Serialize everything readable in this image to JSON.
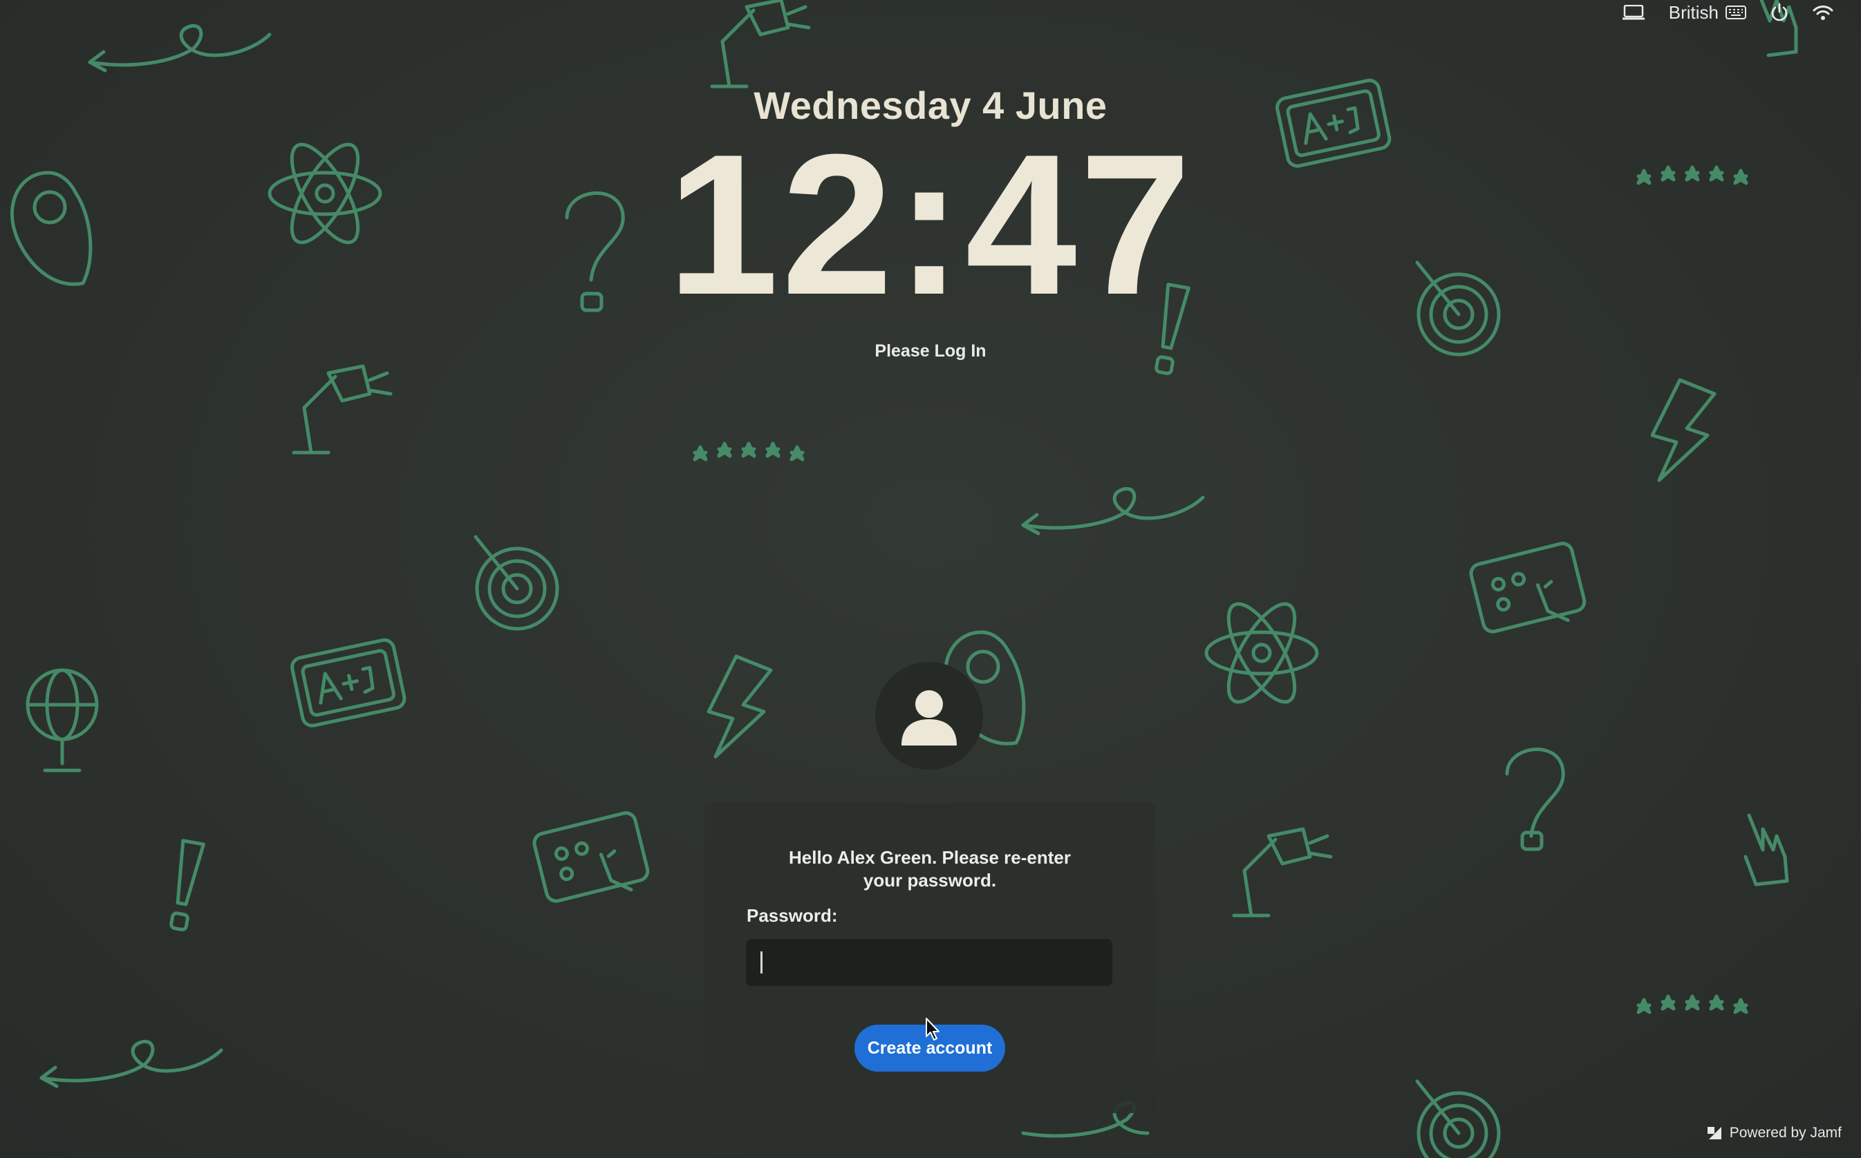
{
  "menubar": {
    "keyboard_layout": "British",
    "icons": [
      "display-icon",
      "keyboard-icon",
      "power-icon",
      "wifi-icon"
    ]
  },
  "clock": {
    "date": "Wednesday 4 June",
    "time": "12:47"
  },
  "login": {
    "prompt": "Please Log In",
    "greeting_line1": "Hello Alex Green. Please re-enter",
    "greeting_line2": "your password.",
    "password_label": "Password:",
    "password_value": "",
    "create_button_label": "Create account"
  },
  "footer": {
    "powered_by": "Powered by Jamf"
  },
  "colors": {
    "background": "#2c312d",
    "doodle": "#4a9a72",
    "button": "#1f6fd6",
    "text": "#ece7d7"
  }
}
